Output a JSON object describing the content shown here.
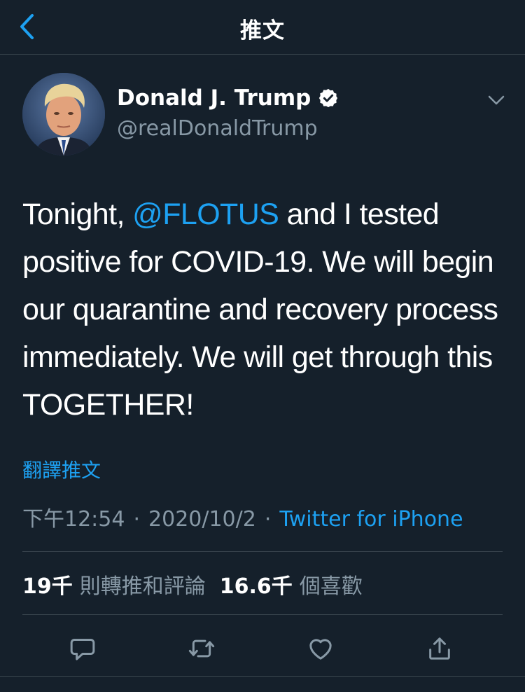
{
  "nav": {
    "title": "推文",
    "back_icon": "chevron-left-icon"
  },
  "author": {
    "name": "Donald J. Trump",
    "handle": "@realDonaldTrump",
    "verified_icon": "verified-badge-icon"
  },
  "tweet": {
    "text_before": "Tonight, ",
    "mention": "@FLOTUS",
    "text_after": " and I tested positive for COVID-19. We will begin our quarantine and recovery process immediately. We will get through this TOGETHER!"
  },
  "translate_label": "翻譯推文",
  "meta": {
    "time": "下午12:54",
    "separator": "·",
    "date": "2020/10/2",
    "source": "Twitter for iPhone"
  },
  "stats": {
    "retweets_count": "19千",
    "retweets_label": "則轉推和評論",
    "likes_count": "16.6千",
    "likes_label": "個喜歡"
  },
  "actions": [
    "reply-icon",
    "retweet-icon",
    "like-icon",
    "share-icon"
  ],
  "colors": {
    "background": "#15202b",
    "accent": "#1da1f2",
    "secondary_text": "#8899a6",
    "divider": "#38444d"
  }
}
